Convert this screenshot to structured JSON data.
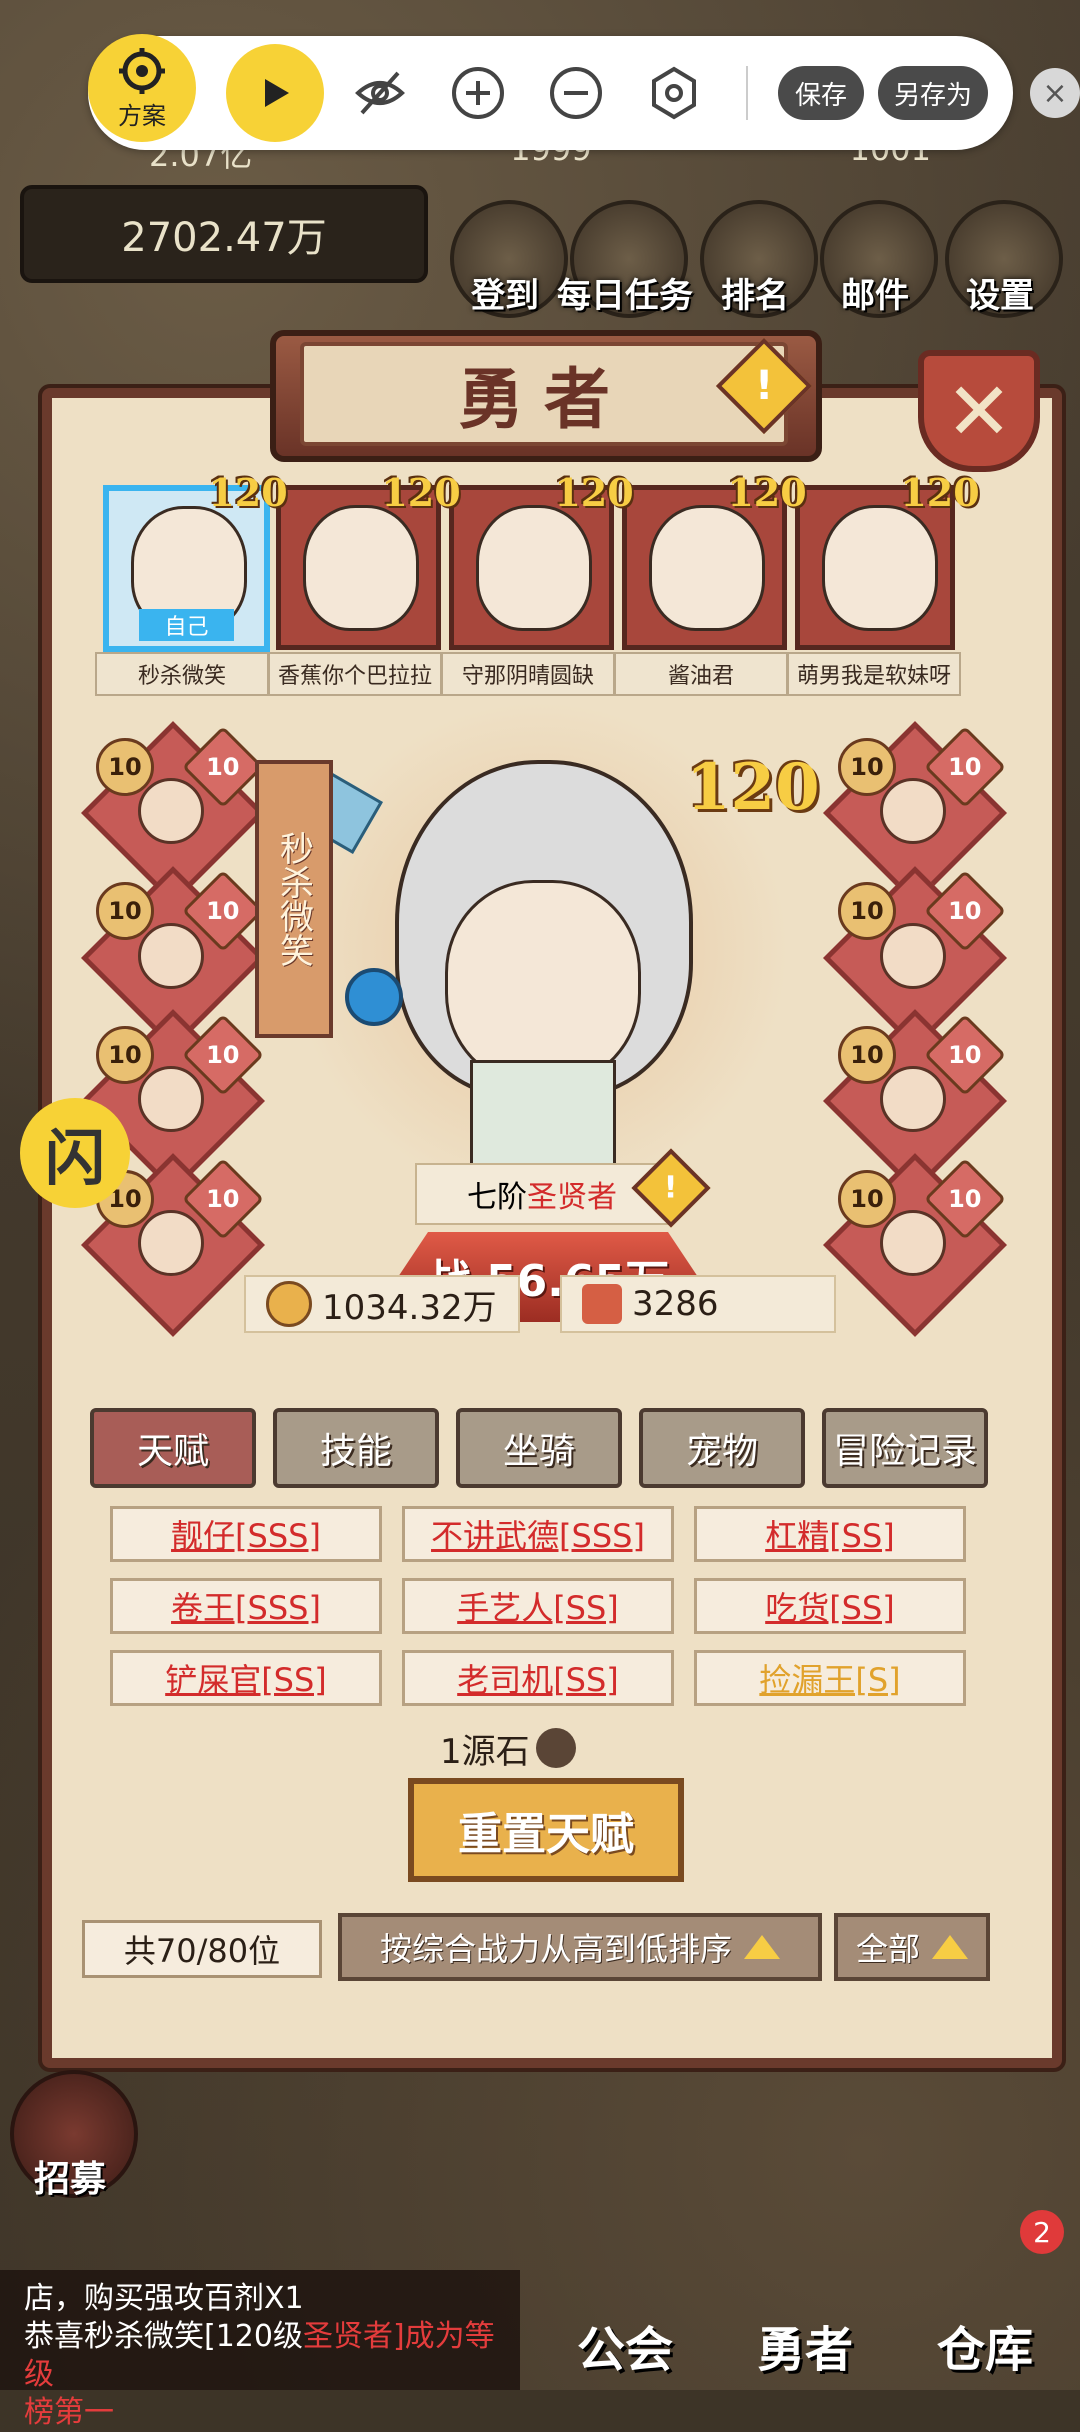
{
  "hud": {
    "gold": "2702.47万",
    "top_partial": [
      "2.07亿",
      "1999",
      "1001"
    ],
    "buttons": [
      "登到",
      "每日任务",
      "排名",
      "邮件",
      "设置"
    ]
  },
  "control_bar": {
    "plan_label": "方案",
    "save_label": "保存",
    "save_as_label": "另存为",
    "close": "×"
  },
  "panel": {
    "title": "勇者",
    "warn": "!",
    "close": "✕"
  },
  "heroes": [
    {
      "name": "秒杀微笑",
      "level": "120",
      "tag": "自己"
    },
    {
      "name": "香蕉你个巴拉拉",
      "level": "120"
    },
    {
      "name": "守那阴晴圆缺",
      "level": "120"
    },
    {
      "name": "酱油君",
      "level": "120"
    },
    {
      "name": "萌男我是软妹呀",
      "level": "120"
    }
  ],
  "selected": {
    "name": "秒杀微笑",
    "level": "120",
    "rank_prefix": "七阶",
    "rank_class": "圣贤者",
    "power_label": "战",
    "power": "56.65万",
    "gold": "1034.32万",
    "scrolls": "3286"
  },
  "equipment_levels": [
    "10",
    "10",
    "10",
    "10",
    "10",
    "10",
    "10",
    "10",
    "10",
    "10",
    "10",
    "10",
    "10",
    "10",
    "10",
    "10"
  ],
  "tabs": [
    "天赋",
    "技能",
    "坐骑",
    "宠物",
    "冒险记录"
  ],
  "talents": [
    {
      "label": "靓仔[SSS]",
      "color": "red"
    },
    {
      "label": "不讲武德[SSS]",
      "color": "red"
    },
    {
      "label": "杠精[SS]",
      "color": "red"
    },
    {
      "label": "卷王[SSS]",
      "color": "red"
    },
    {
      "label": "手艺人[SS]",
      "color": "red"
    },
    {
      "label": "吃货[SS]",
      "color": "red"
    },
    {
      "label": "铲屎官[SS]",
      "color": "red"
    },
    {
      "label": "老司机[SS]",
      "color": "red"
    },
    {
      "label": "捡漏王[S]",
      "color": "gold"
    }
  ],
  "reset": {
    "cost": "1源石",
    "button": "重置天赋"
  },
  "footer": {
    "count": "共70/80位",
    "sort": "按综合战力从高到低排序",
    "filter": "全部"
  },
  "side": {
    "flash": "闪"
  },
  "recruit": "招募",
  "chat": {
    "line1": "店，购买强攻百剂X1",
    "line2_a": "恭喜秒杀微笑[120级",
    "line2_b": "圣贤者",
    "line2_c": "]成为等级",
    "line3": "榜第一"
  },
  "nav": [
    "公会",
    "勇者",
    "仓库"
  ],
  "nav_badge": "2",
  "colors": {
    "accent_yellow": "#f7d236",
    "panel_bg": "#eee0c5",
    "talent_red": "#d32b2b",
    "talent_gold": "#e1a22c"
  }
}
